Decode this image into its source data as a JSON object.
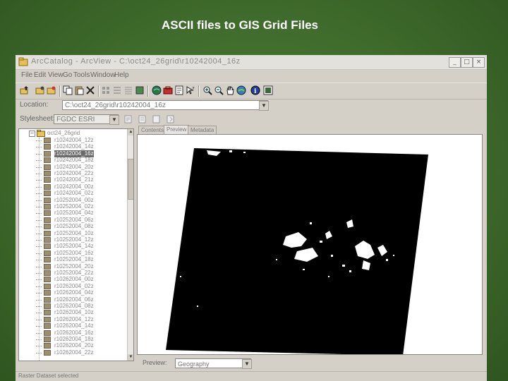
{
  "slide": {
    "title": "ASCII files to GIS Grid Files"
  },
  "window": {
    "title": "ArcCatalog - ArcView - C:\\oct24_26grid\\r10242004_16z",
    "controls": {
      "minimize": "_",
      "maximize": "□",
      "close": "×"
    }
  },
  "menu": [
    "File",
    "Edit",
    "View",
    "Go",
    "Tools",
    "Window",
    "Help"
  ],
  "toolbar": {
    "icons": [
      "up-one-level-icon",
      "connect-folder-icon",
      "disconnect-folder-icon",
      "copy-icon",
      "paste-icon",
      "delete-icon",
      "large-icons-icon",
      "list-icon",
      "details-icon",
      "thumbnails-icon",
      "arcmap-icon",
      "arctoolbox-icon",
      "metadata-icon",
      "whats-this-icon",
      "zoom-in-icon",
      "zoom-out-icon",
      "pan-icon",
      "full-extent-icon",
      "identify-icon",
      "create-thumbnail-icon"
    ]
  },
  "location": {
    "label": "Location:",
    "value": "C:\\oct24_26grid\\r10242004_16z"
  },
  "stylesheet": {
    "label": "Stylesheet:",
    "value": "FGDC ESRI"
  },
  "tree": {
    "root": "oct24_26grid",
    "items": [
      "r10242004_12z",
      "r10242004_14z",
      "r10242004_16z",
      "r10242004_18z",
      "r10242004_20z",
      "r10242004_22z",
      "r10242004_21z",
      "r10242004_00z",
      "r10242004_02z",
      "r10252004_00z",
      "r10252004_02z",
      "r10252004_04z",
      "r10252004_06z",
      "r10252004_08z",
      "r10252004_10z",
      "r10252004_12z",
      "r10252004_14z",
      "r10252004_16z",
      "r10252004_18z",
      "r10252004_20z",
      "r10252004_22z",
      "r10262004_00z",
      "r10262004_02z",
      "r10262004_04z",
      "r10262004_06z",
      "r10262004_08z",
      "r10262004_10z",
      "r10262004_12z",
      "r10262004_14z",
      "r10262004_16z",
      "r10262004_18z",
      "r10262004_20z",
      "r10262004_22z"
    ],
    "selected_index": 2
  },
  "tabs": [
    "Contents",
    "Preview",
    "Metadata"
  ],
  "active_tab": 1,
  "preview": {
    "label": "Preview:",
    "value": "Geography"
  },
  "status": {
    "text": "Raster Dataset selected"
  }
}
